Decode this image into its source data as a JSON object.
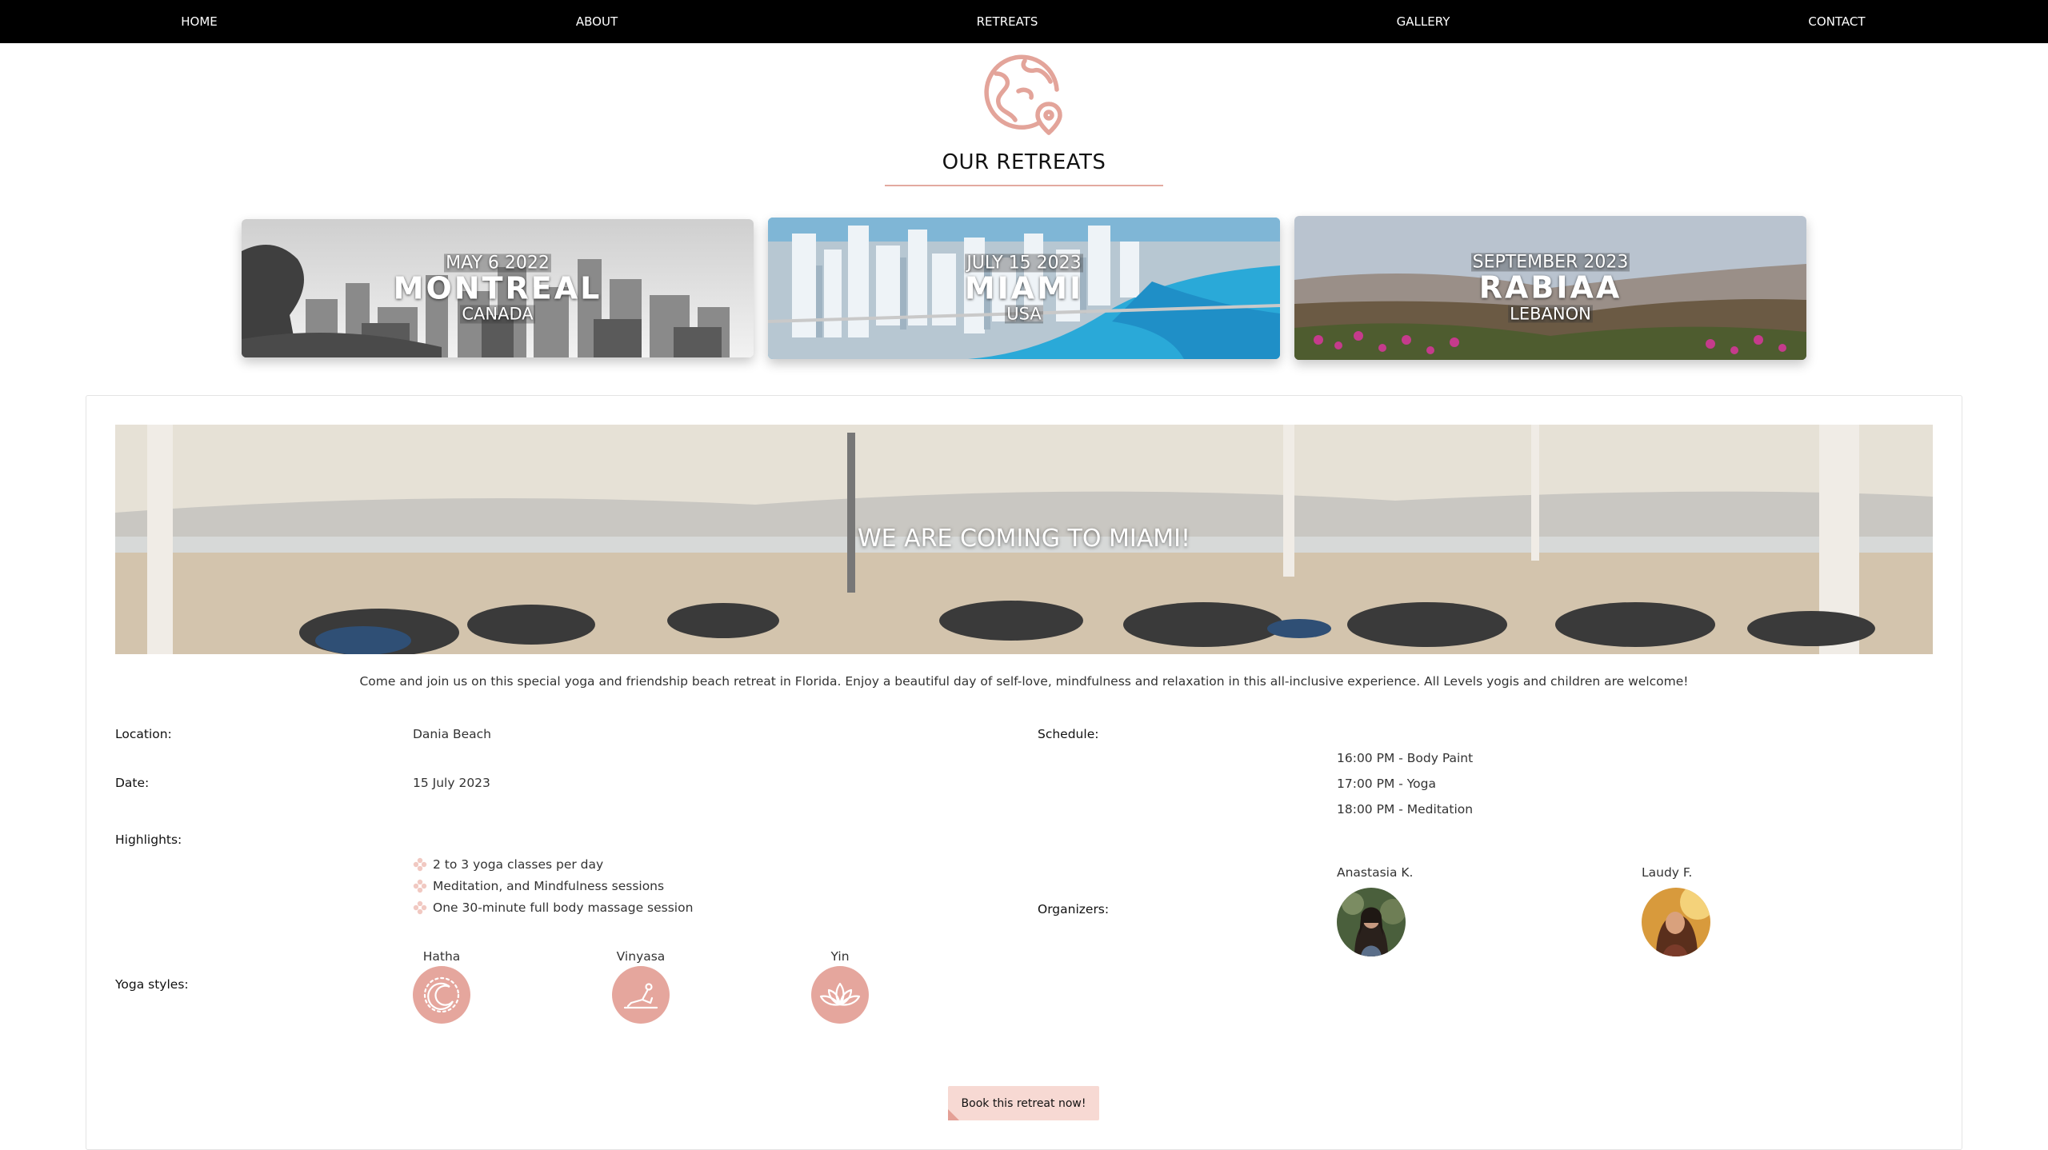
{
  "nav": {
    "items": [
      "HOME",
      "ABOUT",
      "RETREATS",
      "GALLERY",
      "CONTACT"
    ]
  },
  "heading": {
    "icon": "globe-location-icon",
    "title": "OUR RETREATS"
  },
  "retreats": [
    {
      "date": "MAY 6 2022",
      "city": "MONTREAL",
      "country": "CANADA"
    },
    {
      "date": "JULY 15 2023",
      "city": "MIAMI",
      "country": "USA"
    },
    {
      "date": "SEPTEMBER 2023",
      "city": "RABIAA",
      "country": "LEBANON"
    }
  ],
  "detail": {
    "hero_title": "WE ARE COMING TO MIAMI!",
    "intro": "Come and join us on this special yoga and friendship beach retreat in Florida. Enjoy a beautiful day of self-love, mindfulness and relaxation in this all-inclusive experience. All Levels yogis and children are welcome!",
    "location_label": "Location:",
    "location": "Dania Beach",
    "date_label": "Date:",
    "date": "15 July 2023",
    "highlights_label": "Highlights:",
    "highlights": [
      "2 to 3 yoga classes per day",
      "Meditation, and Mindfulness sessions",
      "One 30-minute full body massage session"
    ],
    "yoga_label": "Yoga styles:",
    "yoga_styles": [
      {
        "name": "Hatha",
        "icon": "sun-moon-icon"
      },
      {
        "name": "Vinyasa",
        "icon": "yoga-pose-icon"
      },
      {
        "name": "Yin",
        "icon": "lotus-icon"
      }
    ],
    "schedule_label": "Schedule:",
    "schedule": [
      "16:00 PM - Body Paint",
      "17:00 PM - Yoga",
      "18:00 PM - Meditation"
    ],
    "organizers_label": "Organizers:",
    "organizers": [
      "Anastasia K.",
      "Laudy F."
    ],
    "book_label": "Book this retreat now!"
  },
  "colors": {
    "accent": "#e5a69d",
    "button_bg": "#f7d9d3",
    "nav_bg": "#000000"
  }
}
